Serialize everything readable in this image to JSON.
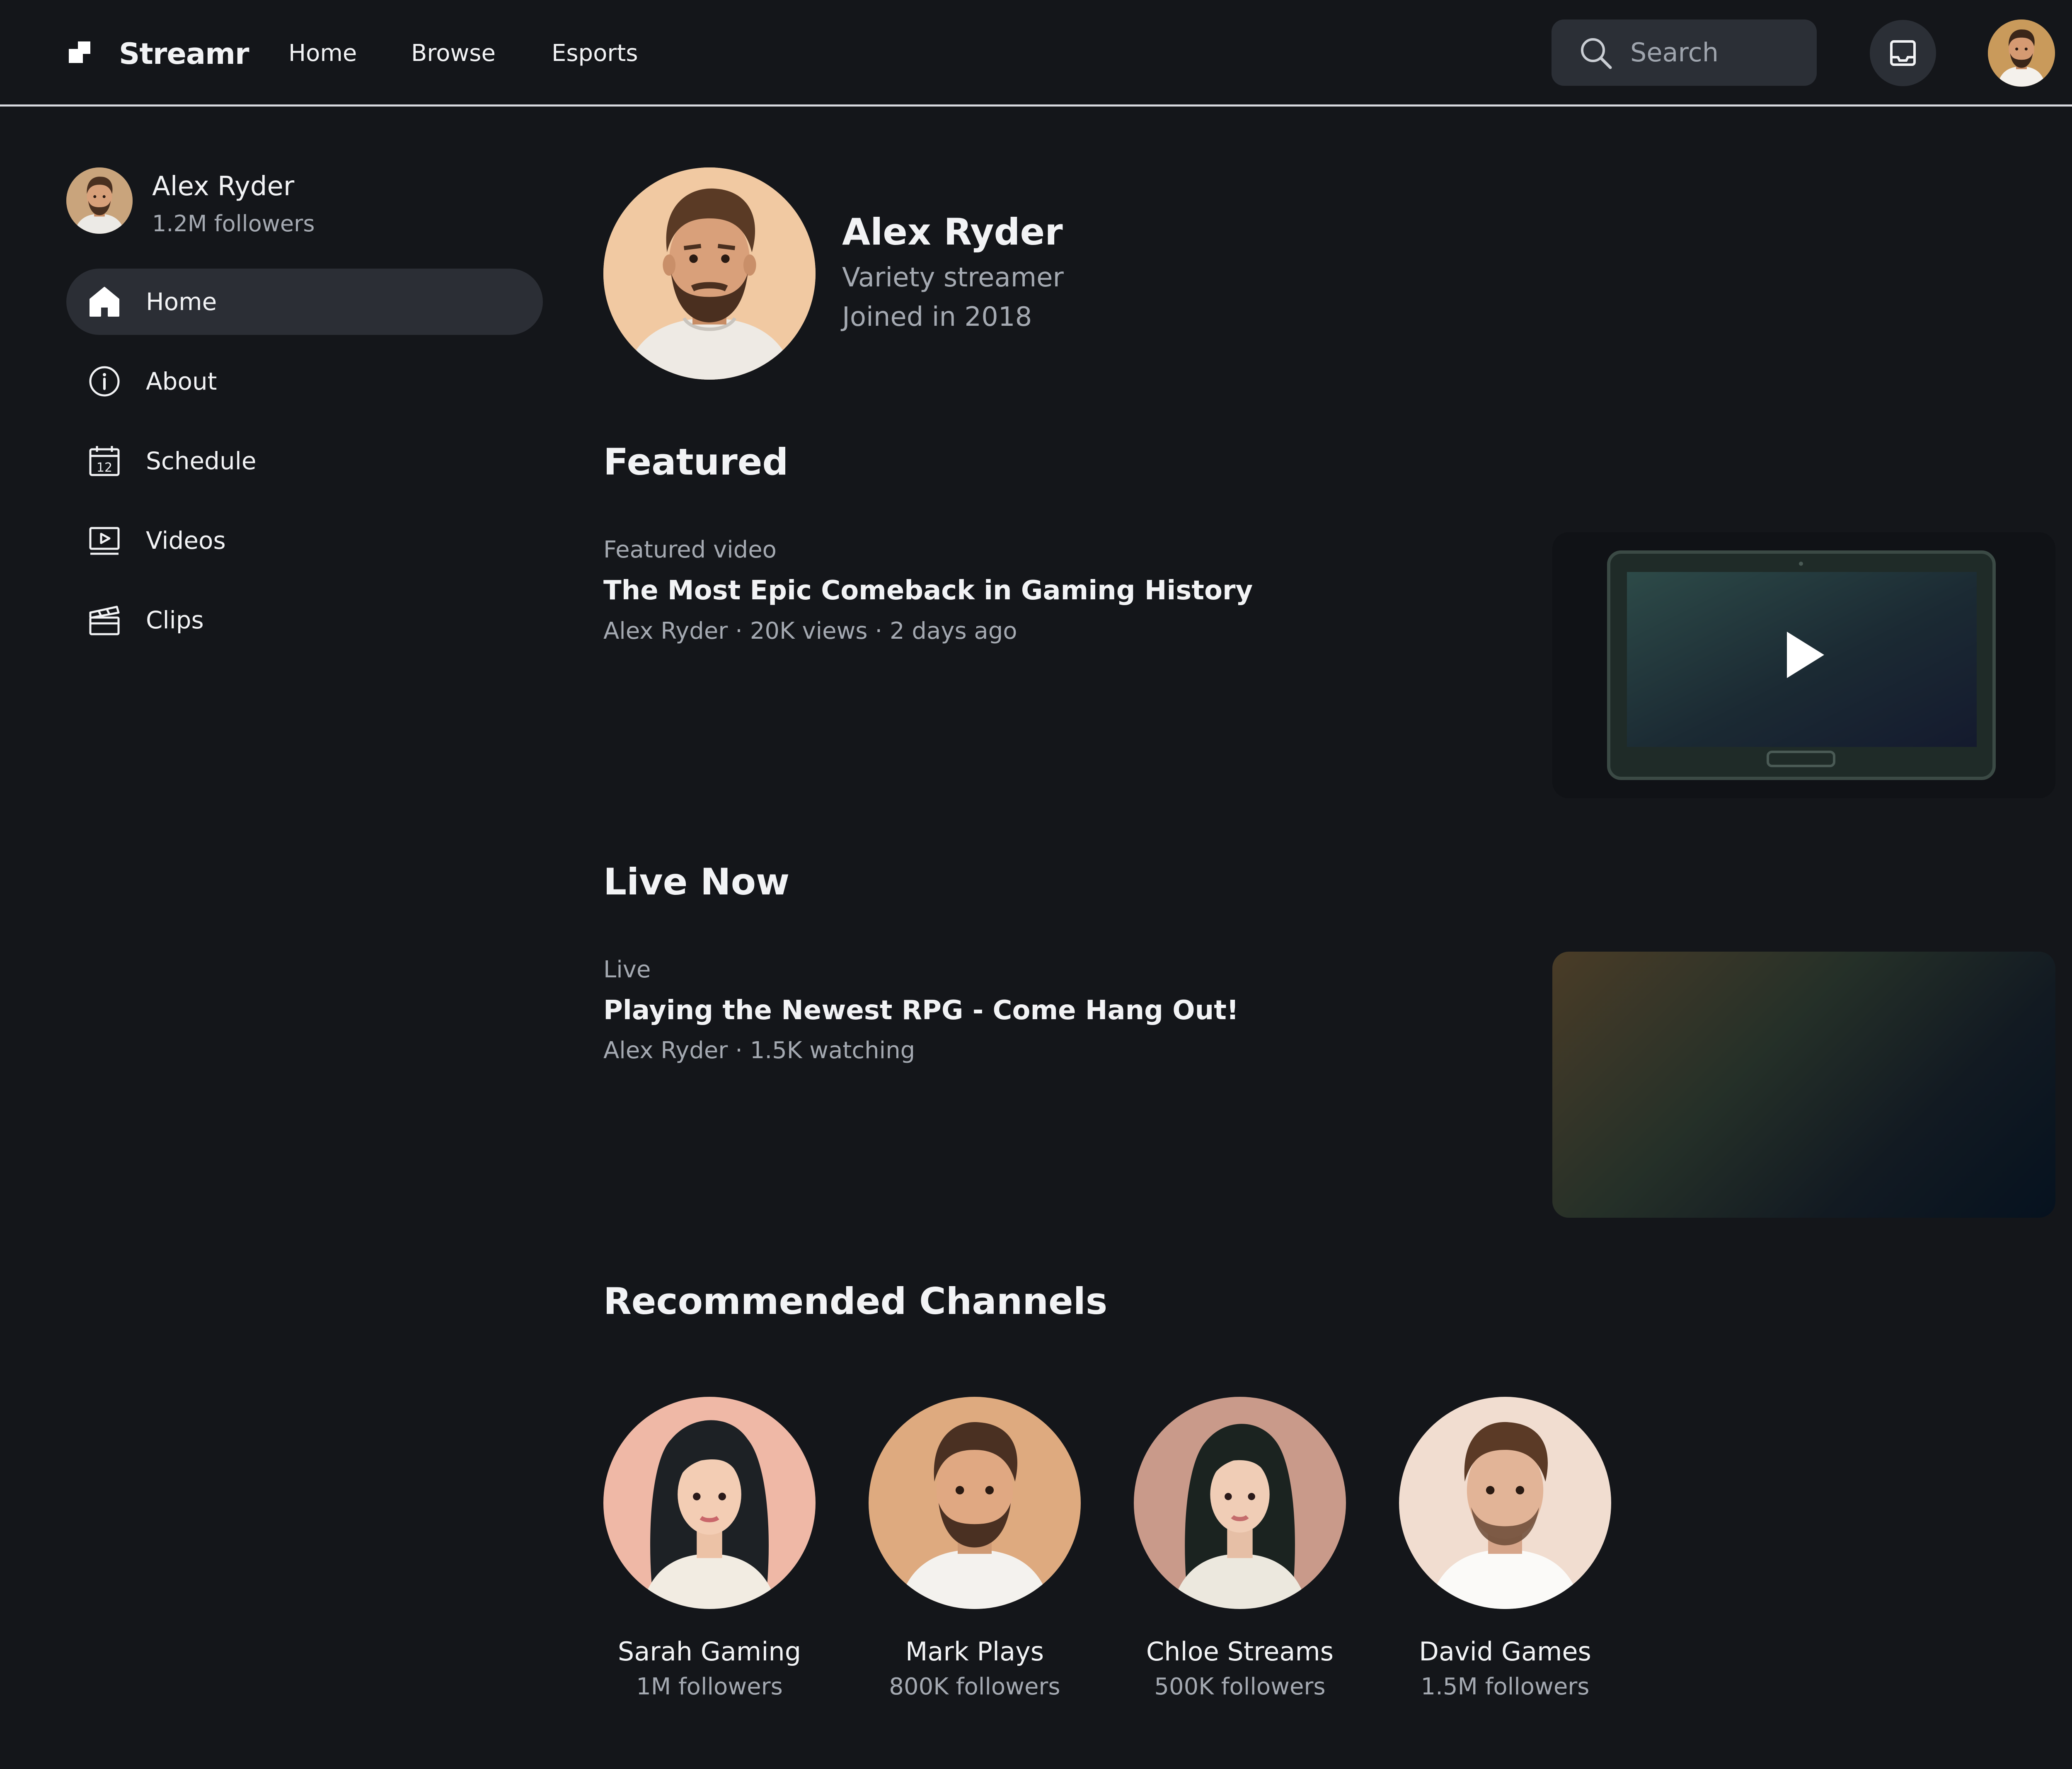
{
  "app": {
    "brand": "Streamr",
    "nav": [
      "Home",
      "Browse",
      "Esports"
    ],
    "search_placeholder": "Search"
  },
  "sidebar": {
    "channel_name": "Alex Ryder",
    "channel_followers": "1.2M followers",
    "items": [
      {
        "label": "Home",
        "icon": "home-icon",
        "active": true
      },
      {
        "label": "About",
        "icon": "info-icon",
        "active": false
      },
      {
        "label": "Schedule",
        "icon": "calendar-icon",
        "calendar_day": "12",
        "active": false
      },
      {
        "label": "Videos",
        "icon": "video-icon",
        "active": false
      },
      {
        "label": "Clips",
        "icon": "clapperboard-icon",
        "active": false
      }
    ]
  },
  "profile": {
    "name": "Alex Ryder",
    "tagline": "Variety streamer",
    "joined": "Joined in 2018"
  },
  "featured": {
    "section_title": "Featured",
    "kicker": "Featured video",
    "title": "The Most Epic Comeback in Gaming History",
    "meta": "Alex Ryder · 20K views · 2 days ago"
  },
  "live": {
    "section_title": "Live Now",
    "kicker": "Live",
    "title": "Playing the Newest RPG - Come Hang Out!",
    "meta": "Alex Ryder · 1.5K watching"
  },
  "recommended": {
    "section_title": "Recommended Channels",
    "channels": [
      {
        "name": "Sarah Gaming",
        "followers": "1M followers"
      },
      {
        "name": "Mark Plays",
        "followers": "800K followers"
      },
      {
        "name": "Chloe Streams",
        "followers": "500K followers"
      },
      {
        "name": "David Games",
        "followers": "1.5M followers"
      }
    ]
  },
  "colors": {
    "background": "#14161a",
    "surface": "#2b2e35",
    "text": "#f2f3f5",
    "muted_text": "#a4a9b1"
  }
}
